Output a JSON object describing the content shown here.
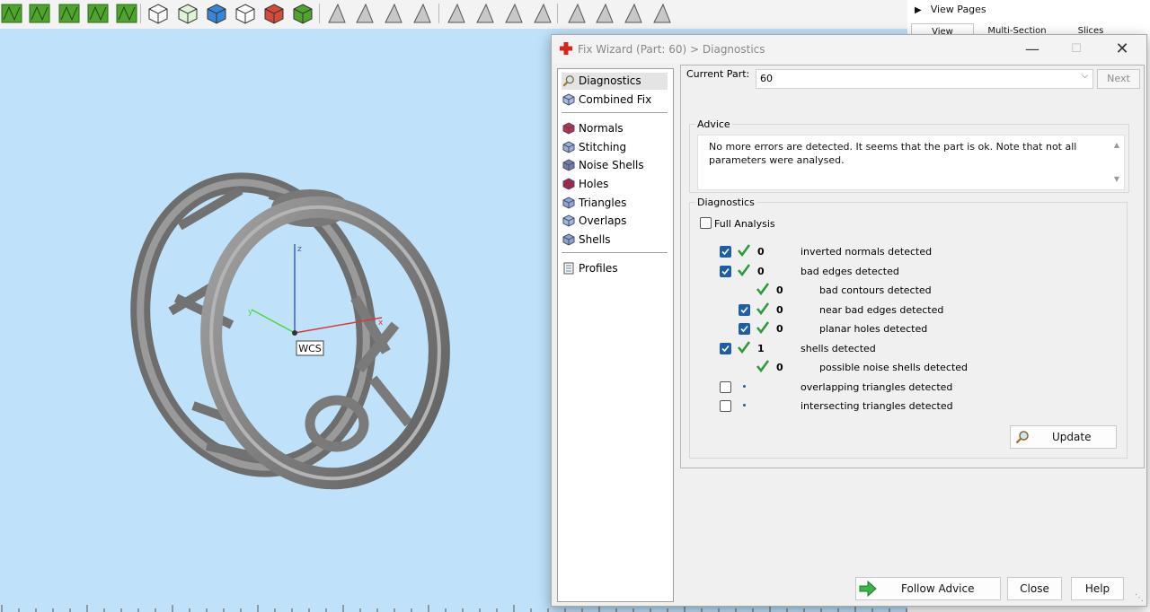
{
  "right_panel": {
    "header": "View Pages",
    "tabs": [
      "View",
      "Multi-Section",
      "Slices"
    ]
  },
  "toolbar": {
    "icons": [
      "wireframe-icon",
      "shaded-icon",
      "cluster-icon",
      "sphere-icon",
      "pie-icon",
      "box-view-icon",
      "box-front-icon",
      "box-color-icon",
      "box-outline-icon",
      "box-red-icon",
      "box-green-icon",
      "triangle-select-icon",
      "triangle-edit-icon",
      "triangle-brush-icon",
      "triangle-blue-icon",
      "triangle-delete-icon",
      "triangle-grey-icon",
      "triangle-copy-icon",
      "triangle-flat-icon",
      "triangle-magnify-icon",
      "triangle-view-icon",
      "triangle-eye-icon",
      "triangle-mark-icon"
    ]
  },
  "viewport": {
    "wcs_label": "WCS",
    "axes": {
      "x": "x",
      "y": "y",
      "z": "z"
    }
  },
  "dialog": {
    "title": "Fix Wizard (Part: 60) > Diagnostics",
    "nav": {
      "group1": [
        {
          "label": "Diagnostics",
          "icon": "magnifier-icon",
          "selected": true
        },
        {
          "label": "Combined Fix",
          "icon": "cube-fix-icon",
          "selected": false
        }
      ],
      "group2": [
        {
          "label": "Normals",
          "icon": "normals-cube-icon"
        },
        {
          "label": "Stitching",
          "icon": "stitching-cube-icon"
        },
        {
          "label": "Noise Shells",
          "icon": "noise-shells-icon"
        },
        {
          "label": "Holes",
          "icon": "holes-cube-icon"
        },
        {
          "label": "Triangles",
          "icon": "triangles-cube-icon"
        },
        {
          "label": "Overlaps",
          "icon": "overlaps-cube-icon"
        },
        {
          "label": "Shells",
          "icon": "shells-cube-icon"
        }
      ],
      "group3": [
        {
          "label": "Profiles",
          "icon": "document-icon"
        }
      ]
    },
    "current_part_label": "Current Part:",
    "current_part_value": "60",
    "next_label": "Next",
    "advice": {
      "title": "Advice",
      "text": "No more errors are detected. It seems that the part is ok. Note that not all parameters were analysed."
    },
    "diagnostics": {
      "title": "Diagnostics",
      "full_analysis_label": "Full Analysis",
      "full_analysis_checked": false,
      "rows": [
        {
          "indent": 0,
          "checkbox": true,
          "checked": true,
          "status": "ok",
          "count": "0",
          "desc": "inverted normals detected"
        },
        {
          "indent": 0,
          "checkbox": true,
          "checked": true,
          "status": "ok",
          "count": "0",
          "desc": "bad edges detected"
        },
        {
          "indent": 1,
          "checkbox": false,
          "checked": false,
          "status": "ok",
          "count": "0",
          "desc": "bad contours detected"
        },
        {
          "indent": 1,
          "checkbox": true,
          "checked": true,
          "status": "ok",
          "count": "0",
          "desc": "near bad edges detected"
        },
        {
          "indent": 1,
          "checkbox": true,
          "checked": true,
          "status": "ok",
          "count": "0",
          "desc": "planar holes detected"
        },
        {
          "indent": 0,
          "checkbox": true,
          "checked": true,
          "status": "ok",
          "count": "1",
          "desc": "shells detected"
        },
        {
          "indent": 1,
          "checkbox": false,
          "checked": false,
          "status": "ok",
          "count": "0",
          "desc": "possible noise shells detected"
        },
        {
          "indent": 0,
          "checkbox": true,
          "checked": false,
          "status": "dot",
          "count": "",
          "desc": "overlapping triangles detected"
        },
        {
          "indent": 0,
          "checkbox": true,
          "checked": false,
          "status": "dot",
          "count": "",
          "desc": "intersecting triangles detected"
        }
      ],
      "update_label": "Update"
    },
    "buttons": {
      "follow_advice": "Follow Advice",
      "close": "Close",
      "help": "Help"
    }
  },
  "colors": {
    "viewport_bg": "#bfe1f9",
    "model_gray": "#8a8a8a",
    "check_green": "#2e9a3c",
    "checkbox_blue": "#1e5ea8",
    "title_cross_red": "#d9241b"
  }
}
